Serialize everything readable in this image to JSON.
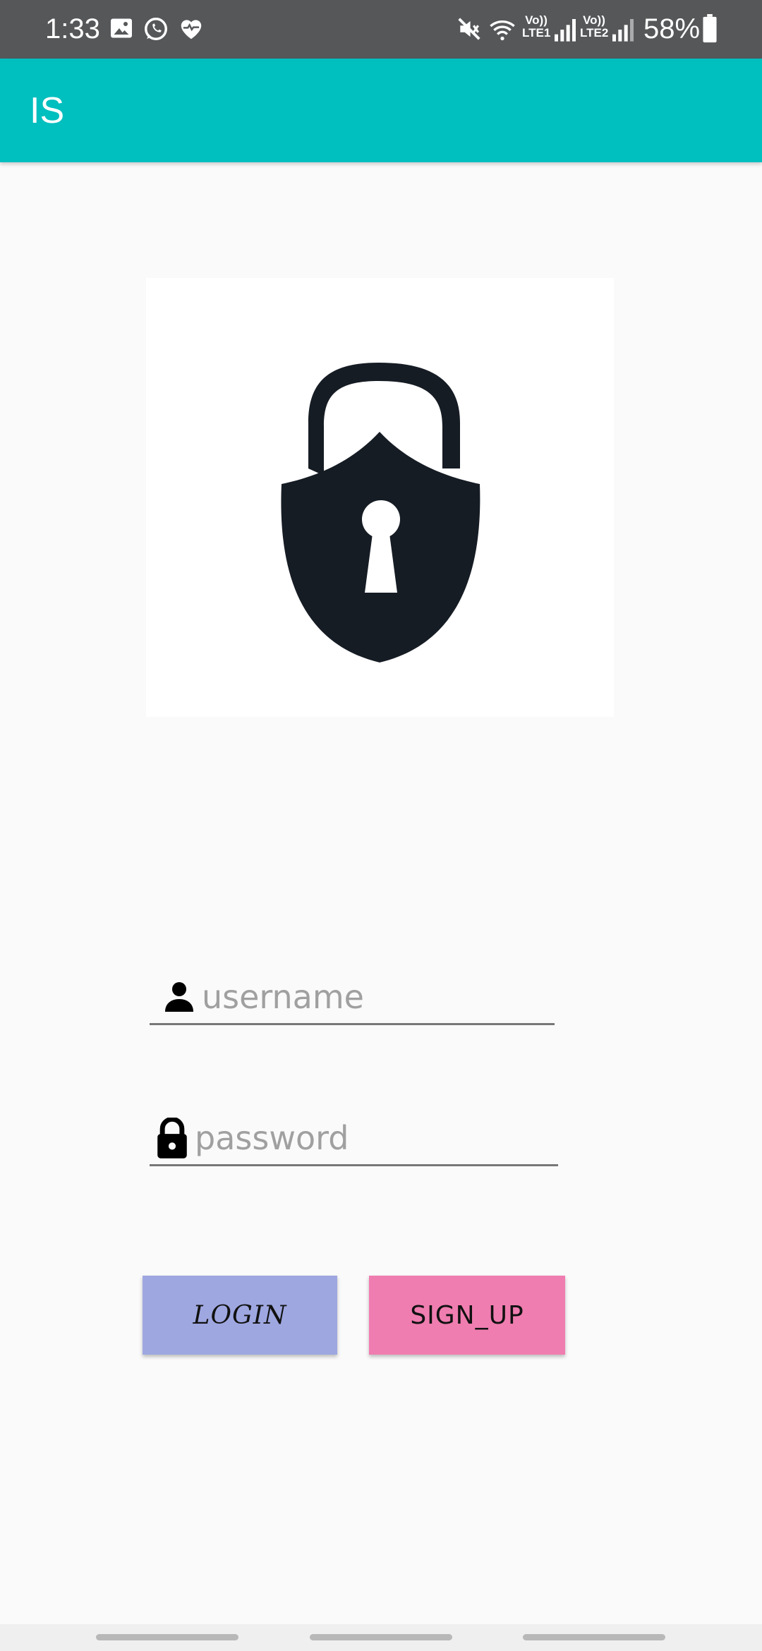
{
  "status_bar": {
    "time": "1:33",
    "battery_percent": "58%",
    "sim1_label_top": "Vo))",
    "sim1_label_bottom": "LTE1",
    "sim2_label_top": "Vo))",
    "sim2_label_bottom": "LTE2",
    "notification_icons": [
      "gallery-icon",
      "whatsapp-icon",
      "health-icon"
    ],
    "system_icons": [
      "mute-icon",
      "wifi-icon",
      "signal-icon",
      "battery-icon"
    ]
  },
  "app_bar": {
    "title": "IS",
    "color": "#00bfbf"
  },
  "logo": {
    "icon": "shield-padlock-icon"
  },
  "form": {
    "username_placeholder": "username",
    "username_icon": "person-icon",
    "password_placeholder": "password",
    "password_icon": "lock-icon"
  },
  "buttons": {
    "login_label": "LOGIN",
    "login_color": "#9ea7e0",
    "signup_label": "SIGN_UP",
    "signup_color": "#ef7db0"
  },
  "nav_bar": {
    "items": [
      "recent-apps",
      "home",
      "back"
    ]
  }
}
